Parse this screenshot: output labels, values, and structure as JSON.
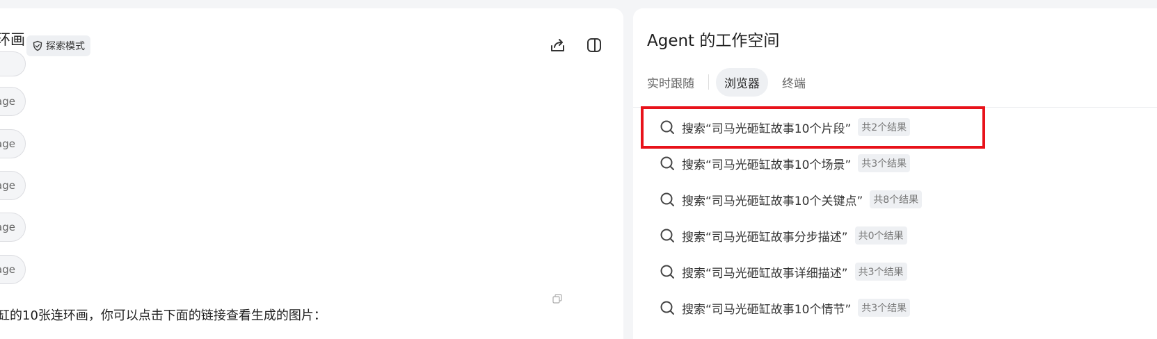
{
  "chat": {
    "title": "环画",
    "mode_badge": "探索模式",
    "image_pills": [
      "age",
      "age",
      "age",
      "age",
      "age"
    ],
    "bottom_text": "缸的10张连环画，你可以点击下面的链接查看生成的图片："
  },
  "workspace": {
    "title": "Agent 的工作空间",
    "tabs": [
      {
        "label": "实时跟随",
        "active": false
      },
      {
        "label": "浏览器",
        "active": true
      },
      {
        "label": "终端",
        "active": false
      }
    ],
    "results": [
      {
        "query": "搜索“司马光砸缸故事10个片段”",
        "count": "共2个结果",
        "highlighted": true
      },
      {
        "query": "搜索“司马光砸缸故事10个场景”",
        "count": "共3个结果",
        "highlighted": false
      },
      {
        "query": "搜索“司马光砸缸故事10个关键点”",
        "count": "共8个结果",
        "highlighted": false
      },
      {
        "query": "搜索“司马光砸缸故事分步描述”",
        "count": "共0个结果",
        "highlighted": false
      },
      {
        "query": "搜索“司马光砸缸故事详细描述”",
        "count": "共3个结果",
        "highlighted": false
      },
      {
        "query": "搜索“司马光砸缸故事10个情节”",
        "count": "共3个结果",
        "highlighted": false
      }
    ]
  },
  "icons": {
    "mode": "shield-icon",
    "share": "share-icon",
    "sidebar": "sidebar-toggle-icon",
    "search": "search-icon",
    "copy": "copy-icon"
  },
  "colors": {
    "highlight": "#e8121a",
    "badge_bg": "#eef0f3"
  }
}
